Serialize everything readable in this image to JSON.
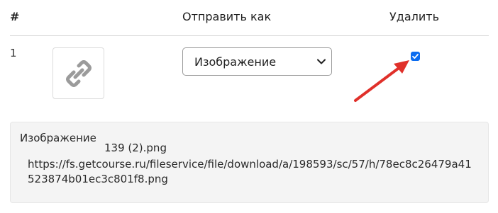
{
  "table": {
    "headers": {
      "num": "#",
      "send_as": "Отправить как",
      "delete": "Удалить"
    },
    "rows": [
      {
        "num": "1",
        "thumbnail_icon": "link-icon",
        "send_as_selected": "Изображение",
        "delete_checked": true
      }
    ]
  },
  "file_info": {
    "type_label": "Изображение",
    "filename": "139 (2).png",
    "url": "https://fs.getcourse.ru/fileservice/file/download/a/198593/sc/57/h/78ec8c26479a41523874b01ec3c801f8.png"
  },
  "colors": {
    "checkbox": "#0b6cf0",
    "annotation_arrow": "#e0302a"
  }
}
